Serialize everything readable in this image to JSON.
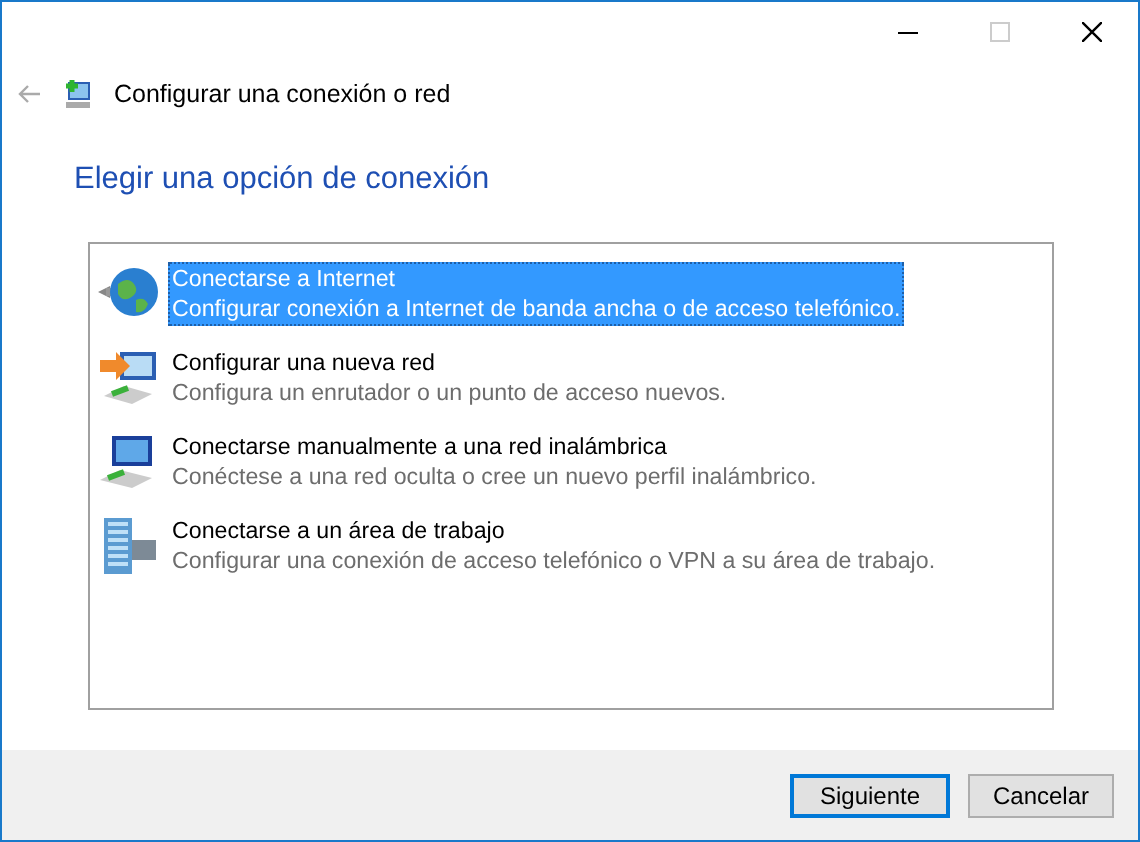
{
  "window": {
    "title": "Configurar una conexión o red"
  },
  "heading": "Elegir una opción de conexión",
  "options": [
    {
      "kind": "internet",
      "title": "Conectarse a Internet",
      "description": "Configurar conexión a Internet de banda ancha o de acceso telefónico.",
      "selected": true
    },
    {
      "kind": "new-network",
      "title": "Configurar una nueva red",
      "description": "Configura un enrutador o un punto de acceso nuevos.",
      "selected": false
    },
    {
      "kind": "wireless",
      "title": "Conectarse manualmente a una red inalámbrica",
      "description": "Conéctese a una red oculta o cree un nuevo perfil inalámbrico.",
      "selected": false
    },
    {
      "kind": "workplace",
      "title": "Conectarse a un área de trabajo",
      "description": "Configurar una conexión de acceso telefónico o VPN a su área de trabajo.",
      "selected": false
    }
  ],
  "buttons": [
    {
      "label": "Siguiente",
      "default": true
    },
    {
      "label": "Cancelar",
      "default": false
    }
  ]
}
